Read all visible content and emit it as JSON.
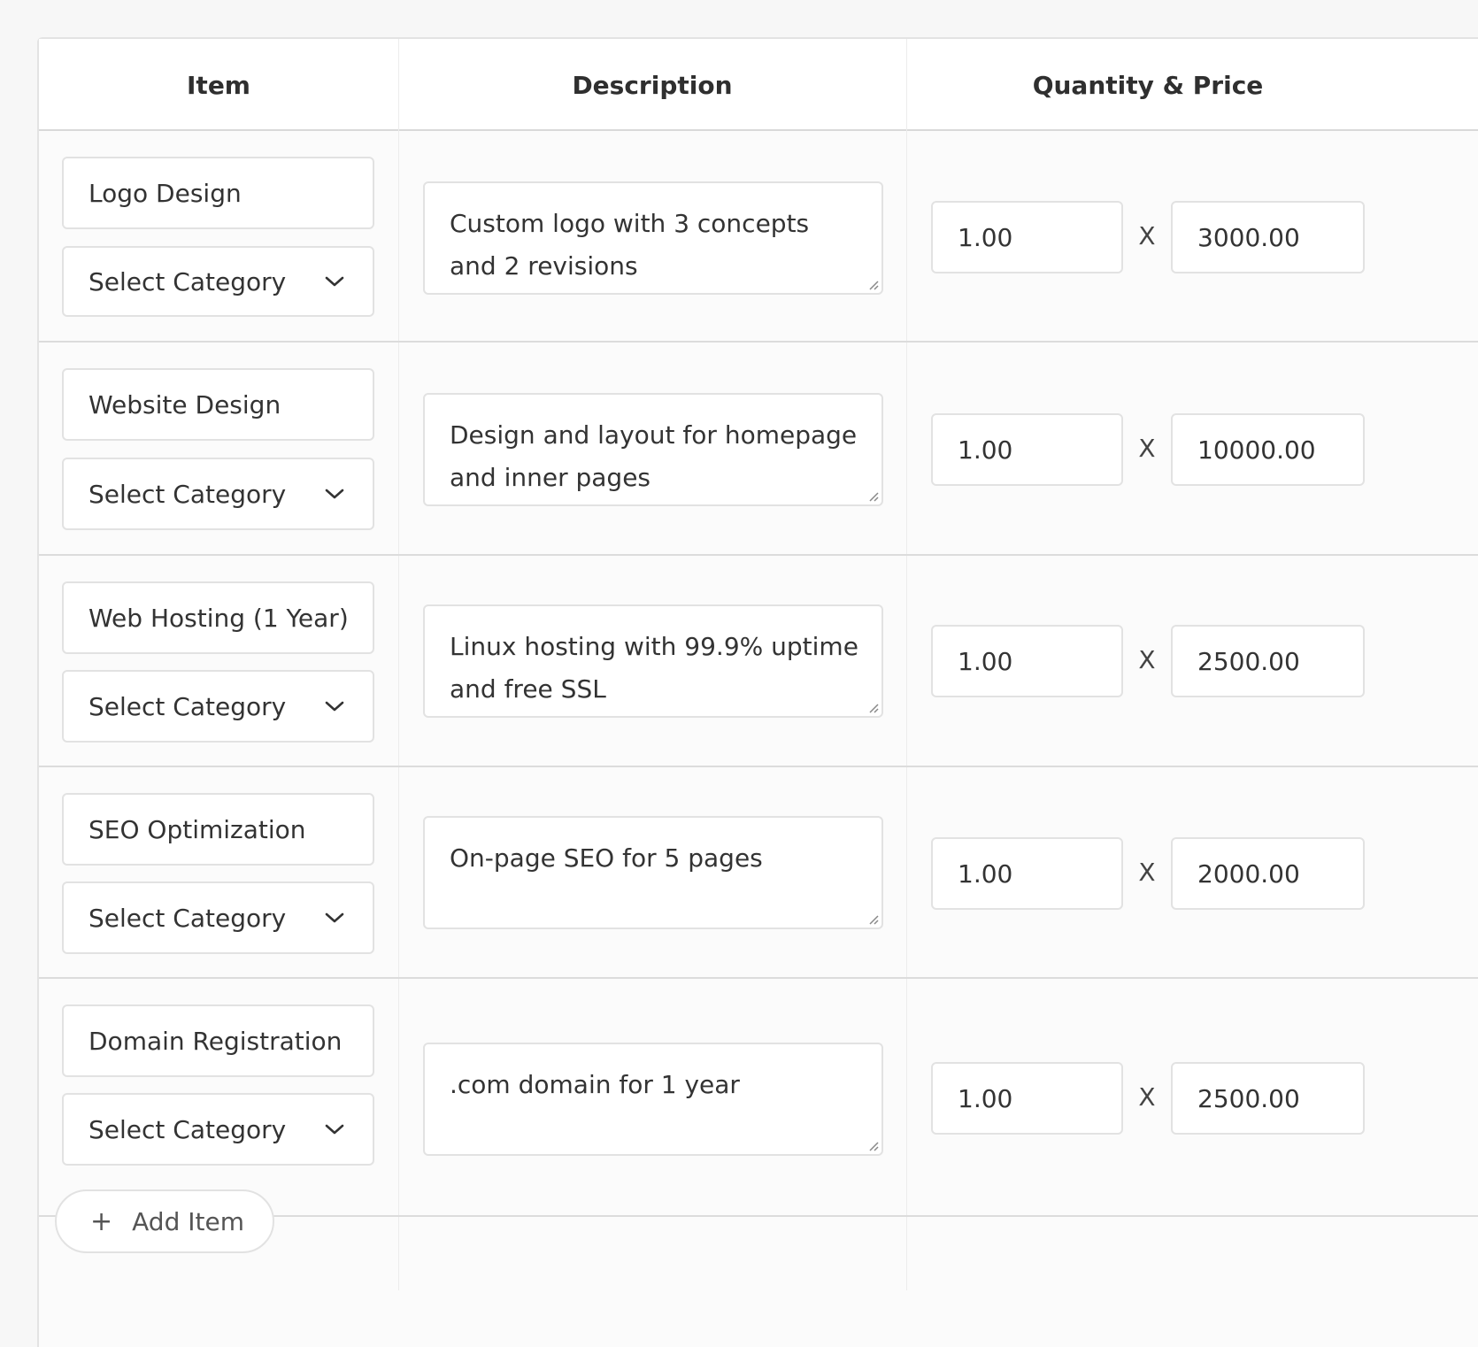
{
  "table": {
    "headers": [
      "Item",
      "Description",
      "Quantity & Price"
    ],
    "multiply_symbol": "X",
    "rows": [
      {
        "item": "Logo Design",
        "category": "Select Category",
        "description": "Custom logo with 3 concepts and 2 revisions",
        "quantity": "1.00",
        "price": "3000.00"
      },
      {
        "item": "Website Design",
        "category": "Select Category",
        "description": "Design and layout for homepage and inner pages",
        "quantity": "1.00",
        "price": "10000.00"
      },
      {
        "item": "Web Hosting (1 Year)",
        "category": "Select Category",
        "description": "Linux hosting with 99.9% uptime and free SSL",
        "quantity": "1.00",
        "price": "2500.00"
      },
      {
        "item": "SEO Optimization",
        "category": "Select Category",
        "description": "On-page SEO for 5 pages",
        "quantity": "1.00",
        "price": "2000.00"
      },
      {
        "item": "Domain Registration",
        "category": "Select Category",
        "description": ".com domain for 1 year",
        "quantity": "1.00",
        "price": "2500.00"
      }
    ]
  },
  "add_item": {
    "icon": "plus-icon",
    "label": "Add Item"
  },
  "icons": {
    "select": "chevron-down-icon",
    "resize": "resize-grip-icon"
  }
}
